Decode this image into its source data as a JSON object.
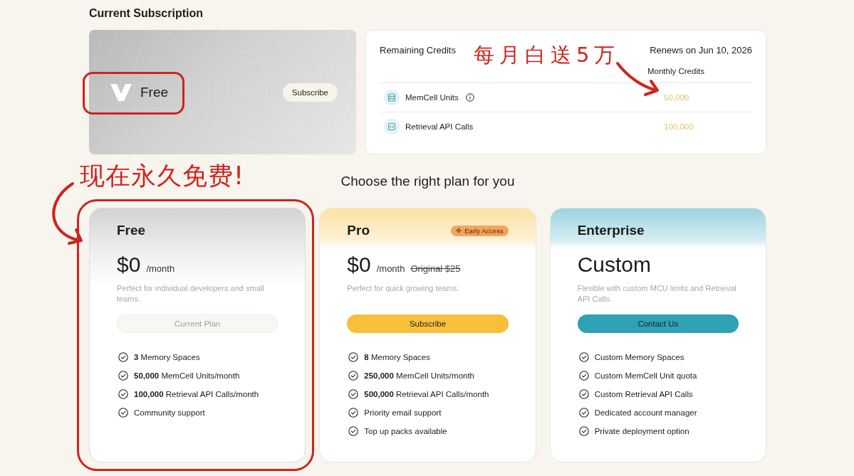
{
  "current_subscription": {
    "title": "Current Subscription",
    "plan": "Free",
    "button": "Subscribe"
  },
  "credits": {
    "title": "Remaining Credits",
    "renews": "Renews on Jun 10, 2026",
    "column": "Monthly Credits",
    "rows": [
      {
        "name": "MemCell Units",
        "info": true,
        "value": "50,000"
      },
      {
        "name": "Retrieval API Calls",
        "info": false,
        "value": "100,000"
      }
    ]
  },
  "plans_heading": "Choose the right plan for you",
  "plans": [
    {
      "kind": "free",
      "name": "Free",
      "price": "$0",
      "period": "/month",
      "description": "Perfect for individual developers and small teams.",
      "button": {
        "label": "Current Plan",
        "disabled": true
      },
      "features": [
        "**3** Memory Spaces",
        "**50,000** MemCell Units/month",
        "**100,000** Retrieval API Calls/month",
        "Community support"
      ]
    },
    {
      "kind": "pro",
      "name": "Pro",
      "badge": "Early Access",
      "price": "$0",
      "period": "/month",
      "original_price": "Original $25",
      "description": "Perfect for quick growing teams.",
      "button": {
        "label": "Subscribe",
        "disabled": false
      },
      "features": [
        "**8** Memory Spaces",
        "**250,000** MemCell Units/month",
        "**500,000** Retrieval API Calls/month",
        "Priority email support",
        "Top up packs available"
      ]
    },
    {
      "kind": "enterprise",
      "name": "Enterprise",
      "price": "Custom",
      "description": "Flexible with custom MCU limits and Retrieval API Calls.",
      "button": {
        "label": "Contact Us",
        "disabled": false
      },
      "features": [
        "Custom Memory Spaces",
        "Custom MemCell Unit quota",
        "Custom Retrieval API Calls",
        "Dedicated account manager",
        "Private deployment option"
      ]
    }
  ],
  "annotations": [
    {
      "text": "每月白送5万"
    },
    {
      "text": "现在永久免费!"
    }
  ]
}
